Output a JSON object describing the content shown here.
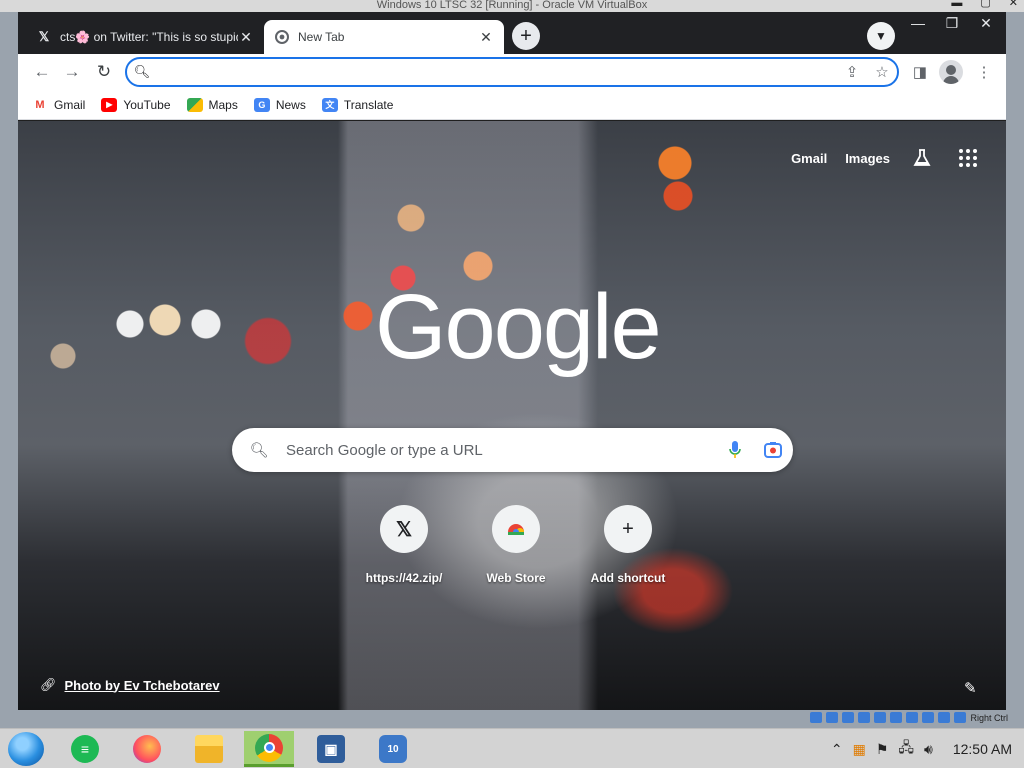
{
  "host": {
    "title": "Windows 10 LTSC 32 [Running] - Oracle VM VirtualBox",
    "right_ctrl": "Right Ctrl"
  },
  "browser": {
    "tabs": [
      {
        "title": "cts🌸 on Twitter: \"This is so stupid",
        "favicon": "x-icon"
      },
      {
        "title": "New Tab",
        "favicon": "chrome-icon"
      }
    ],
    "address": {
      "value": "",
      "placeholder": ""
    },
    "bookmarks": [
      {
        "label": "Gmail",
        "icon": "gmail-icon"
      },
      {
        "label": "YouTube",
        "icon": "youtube-icon"
      },
      {
        "label": "Maps",
        "icon": "maps-icon"
      },
      {
        "label": "News",
        "icon": "news-icon"
      },
      {
        "label": "Translate",
        "icon": "translate-icon"
      }
    ]
  },
  "ntp": {
    "top_links": {
      "gmail": "Gmail",
      "images": "Images"
    },
    "logo": "Google",
    "search_placeholder": "Search Google or type a URL",
    "shortcuts": [
      {
        "label": "https://42.zip/",
        "icon": "x-icon"
      },
      {
        "label": "Web Store",
        "icon": "web-store-icon"
      },
      {
        "label": "Add shortcut",
        "icon": "plus-icon"
      }
    ],
    "attribution": "Photo by Ev Tchebotarev"
  },
  "taskbar": {
    "clock": "12:50 AM",
    "apps": [
      "notes",
      "firefox",
      "file-explorer",
      "chrome",
      "virtualbox",
      "windows-10-vm"
    ]
  },
  "colors": {
    "accent": "#1a73e8",
    "tab_dark": "#202124",
    "taskbar_active": "#9fcf6f"
  }
}
